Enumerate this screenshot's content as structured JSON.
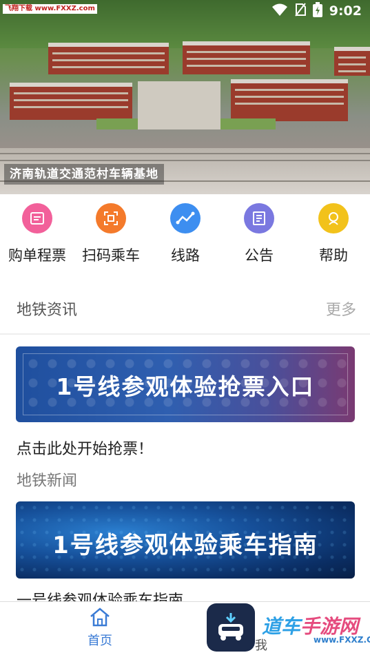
{
  "status_bar": {
    "watermark": "飞翔下载 www.FXXZ.com",
    "time": "9:02"
  },
  "hero": {
    "caption": "济南轨道交通范村车辆基地"
  },
  "quick_actions": [
    {
      "label": "购单程票",
      "icon": "ticket-icon",
      "color": "#f2609a"
    },
    {
      "label": "扫码乘车",
      "icon": "scan-icon",
      "color": "#f47a2b"
    },
    {
      "label": "线路",
      "icon": "route-icon",
      "color": "#3d8ef0"
    },
    {
      "label": "公告",
      "icon": "notice-icon",
      "color": "#7a78e0"
    },
    {
      "label": "帮助",
      "icon": "help-icon",
      "color": "#f2c21b"
    }
  ],
  "news_section": {
    "title": "地铁资讯",
    "more": "更多"
  },
  "feed": {
    "banner1_text": "1号线参观体验抢票入口",
    "item1_title": "点击此处开始抢票！",
    "category": "地铁新闻",
    "banner2_text": "1号线参观体验乘车指南",
    "item2_title": "一号线参观体验乘车指南"
  },
  "tab_bar": {
    "home": "首页",
    "me": "我"
  },
  "corner_watermark": {
    "part1": "道车",
    "part2": "手游网",
    "sub": "www.FXXZ.COM"
  }
}
